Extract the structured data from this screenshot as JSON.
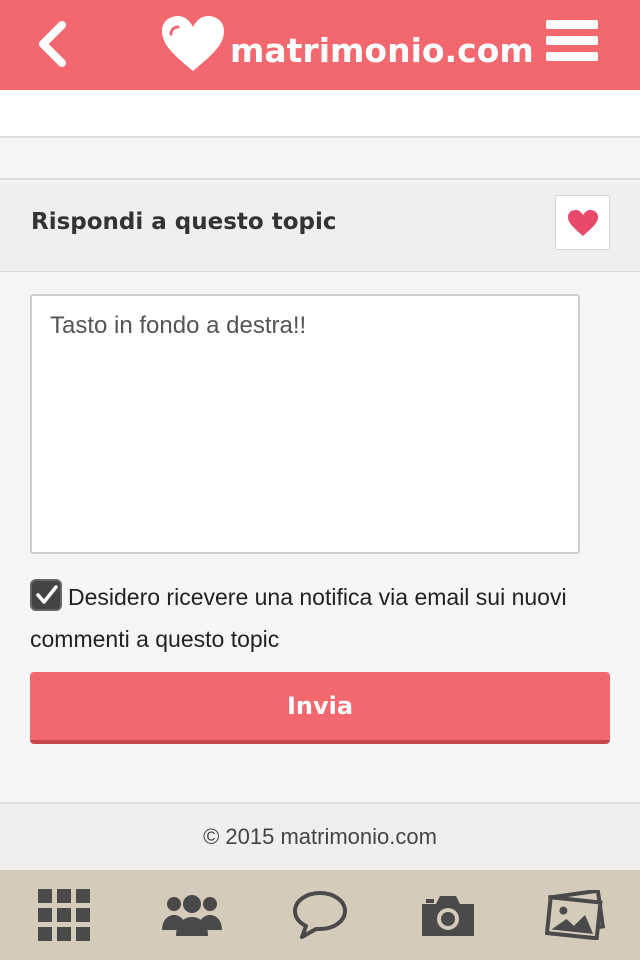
{
  "header": {
    "logo_text": "matrimonio.com",
    "back_icon": "chevron-left-icon",
    "menu_icon": "hamburger-menu-icon"
  },
  "reply": {
    "title": "Rispondi a questo topic",
    "favorite_icon": "heart-icon",
    "textarea_value": "Tasto in fondo a destra!!",
    "notify_label": "Desidero ricevere una notifica via email sui nuovi commenti a questo topic",
    "notify_checked": true,
    "send_label": "Invia"
  },
  "footer": {
    "copyright": "© 2015 matrimonio.com"
  },
  "tabbar": {
    "items": [
      {
        "icon": "grid-icon"
      },
      {
        "icon": "community-icon"
      },
      {
        "icon": "chat-bubble-icon"
      },
      {
        "icon": "camera-icon"
      },
      {
        "icon": "photos-icon"
      }
    ]
  },
  "colors": {
    "brand": "#f2686e",
    "brand_dark": "#c8474e",
    "tabbar": "#d5cbbb",
    "heart": "#e8496b"
  }
}
